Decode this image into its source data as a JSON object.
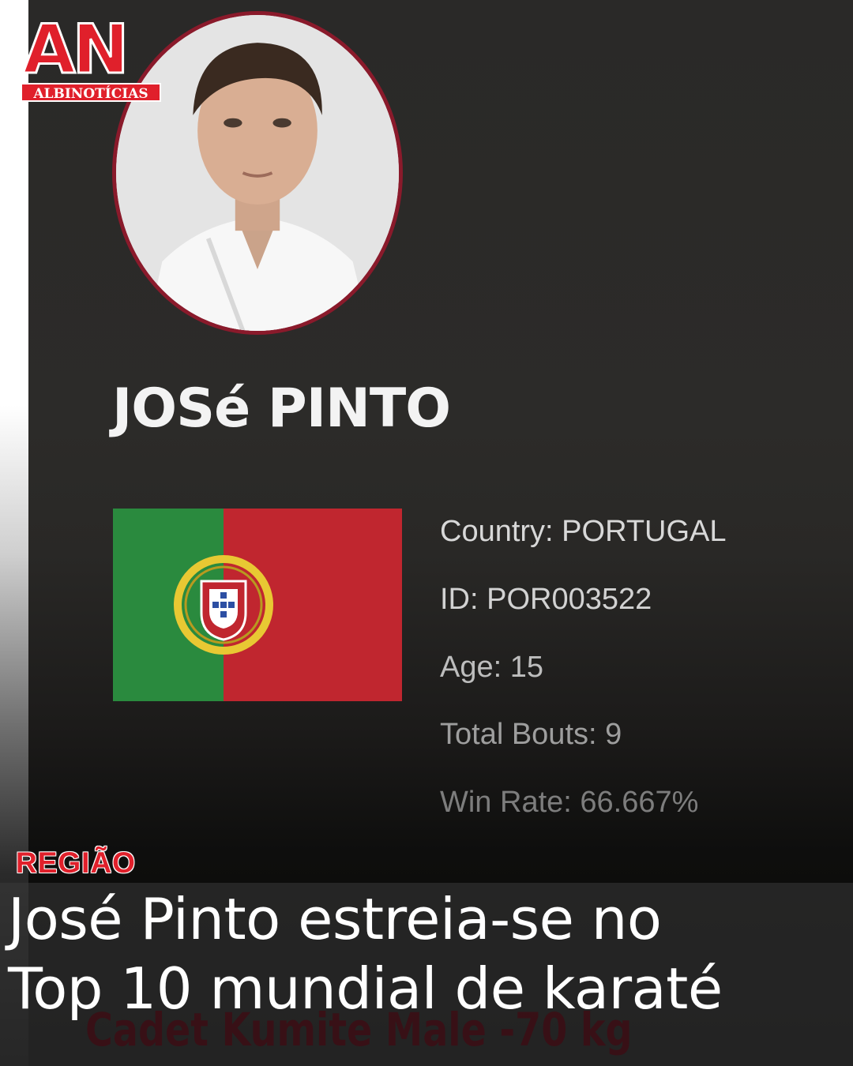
{
  "logo": {
    "letters": "AN",
    "brand": "ALBINOTÍCIAS",
    "color": "#e0202b"
  },
  "profile": {
    "name": "JOSé PINTO",
    "country_flag": "portugal-flag",
    "details": {
      "country": "Country: PORTUGAL",
      "id": "ID: POR003522",
      "age": "Age: 15",
      "total_bouts": "Total Bouts: 9",
      "win_rate": "Win Rate: 66.667%"
    },
    "partial_text": "Cadet Kumite Male -70 kg"
  },
  "article": {
    "section": "REGIÃO",
    "headline_line1": "José Pinto estreia-se no",
    "headline_line2": "Top 10 mundial de karaté"
  },
  "colors": {
    "accent": "#e0202b",
    "portrait_border": "#8a1a2b",
    "flag_green": "#2a8a3e",
    "flag_red": "#c0262f"
  }
}
